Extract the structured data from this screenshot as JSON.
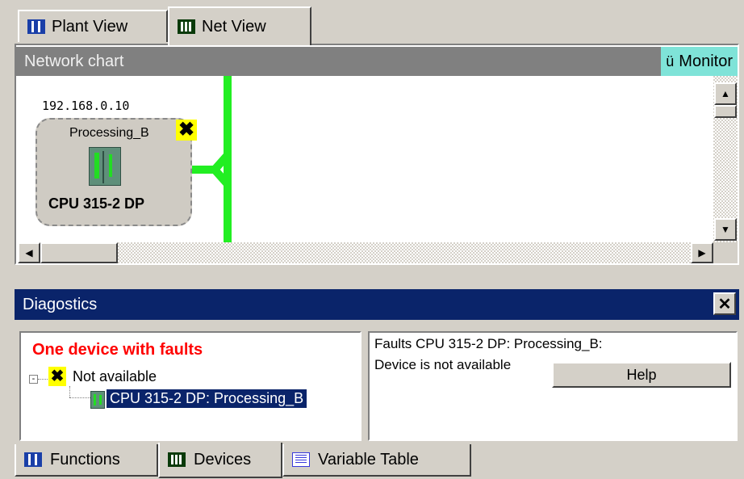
{
  "tabs_top": [
    {
      "label": "Plant View",
      "icon": "plant-view-icon"
    },
    {
      "label": "Net View",
      "icon": "net-view-icon"
    }
  ],
  "network": {
    "header": "Network chart",
    "monitor_label": "Monitor",
    "monitor_color": "#7fe3d8",
    "bus_color": "#22ee22",
    "device": {
      "ip": "192.168.0.10",
      "name": "Processing_B",
      "model": "CPU 315-2 DP",
      "status_icon": "error-x-icon"
    }
  },
  "diagnostics": {
    "title": "Diagostics",
    "close_icon": "close-icon",
    "tree": {
      "summary": "One device with faults",
      "summary_color": "#ff0000",
      "group_label": "Not available",
      "item_label": "CPU 315-2 DP: Processing_B"
    },
    "detail": {
      "line1": "Faults CPU 315-2 DP: Processing_B:",
      "line2": "Device is not available",
      "help_button": "Help"
    }
  },
  "tabs_bottom": [
    {
      "label": "Functions",
      "icon": "functions-icon"
    },
    {
      "label": "Devices",
      "icon": "devices-icon"
    },
    {
      "label": "Variable Table",
      "icon": "variable-table-icon"
    }
  ]
}
